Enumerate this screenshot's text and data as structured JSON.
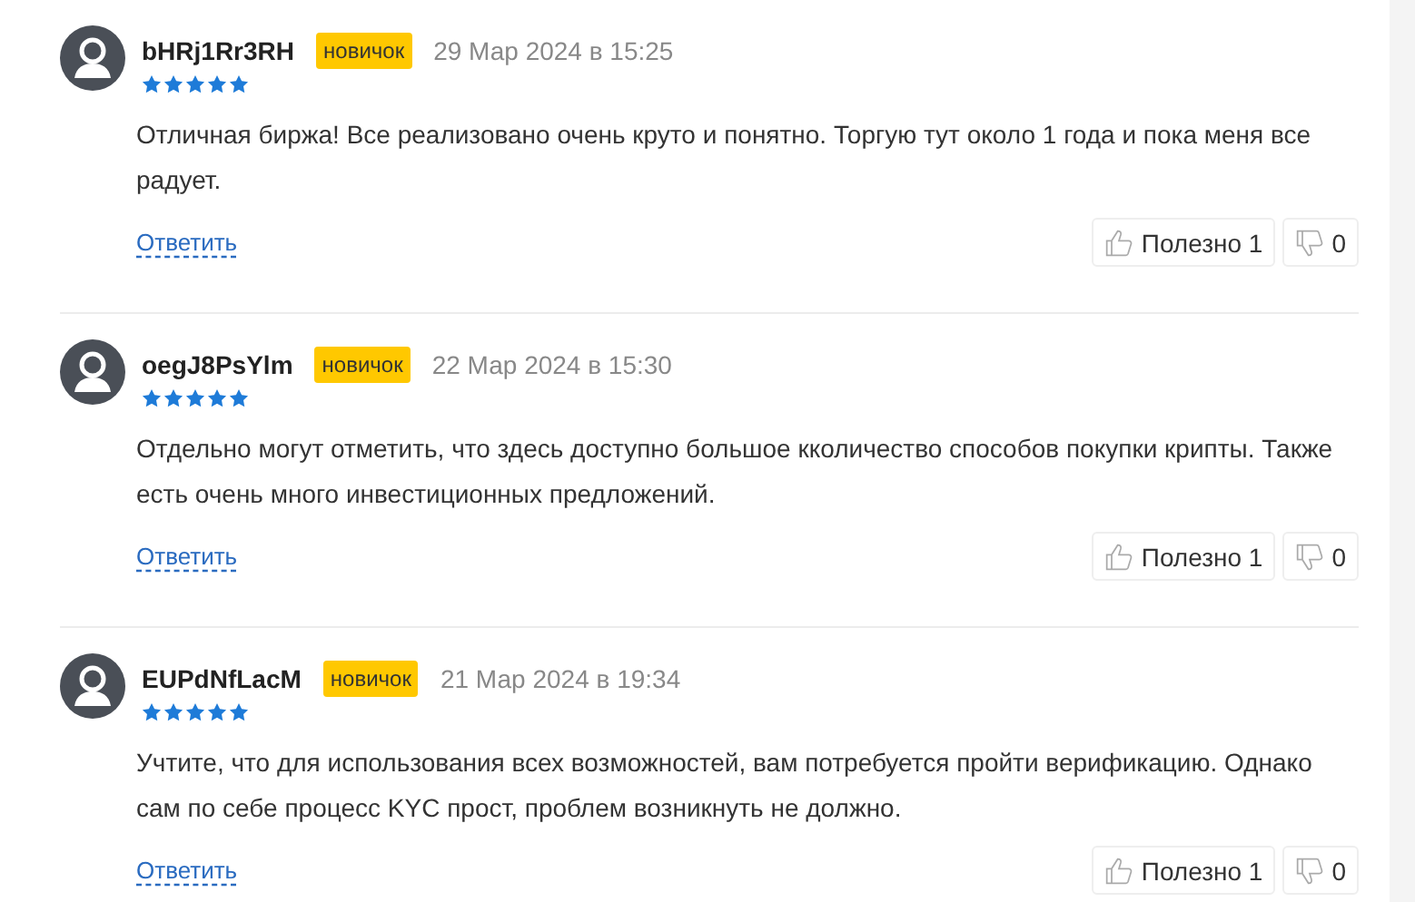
{
  "reviews": [
    {
      "author": "bHRj1Rr3RH",
      "badge": "новичок",
      "date": "29 Мар 2024 в 15:25",
      "stars": 5,
      "text": "Отличная биржа! Все реализовано очень круто и понятно. Торгую тут около 1 года и пока меня все радует.",
      "reply": "Ответить",
      "helpful": "Полезно 1",
      "unhelpful": "0"
    },
    {
      "author": "oegJ8PsYlm",
      "badge": "новичок",
      "date": "22 Мар 2024 в 15:30",
      "stars": 5,
      "text": "Отдельно могут отметить, что здесь доступно большое кколичество способов покупки крипты. Также есть очень много инвестиционных предложений.",
      "reply": "Ответить",
      "helpful": "Полезно 1",
      "unhelpful": "0"
    },
    {
      "author": "EUPdNfLacM",
      "badge": "новичок",
      "date": "21 Мар 2024 в 19:34",
      "stars": 5,
      "text": "Учтите, что для использования всех возможностей, вам потребуется пройти верификацию. Однако сам по себе процесс KYC прост, проблем возникнуть не должно.",
      "reply": "Ответить",
      "helpful": "Полезно 1",
      "unhelpful": "0"
    }
  ]
}
